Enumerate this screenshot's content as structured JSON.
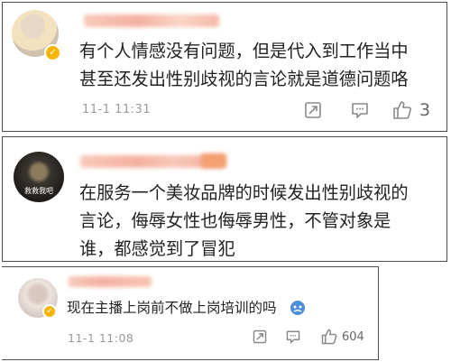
{
  "colors": {
    "border": "#4d4d4d",
    "text": "#222222",
    "meta": "#9a9a9a",
    "verified_badge": "#f7b500",
    "name_blur": "#f5b9a8"
  },
  "comments": [
    {
      "avatar_icon": "user-avatar-icon",
      "verified_icon": "verified-badge-icon",
      "lines": [
        "有个人情感没有问题，但是代入到工作当中",
        "甚至还发出性别歧视的言论就是道德问题咯"
      ],
      "time": "11-1 11:31",
      "share_icon": "share-icon",
      "reply_icon": "comment-icon",
      "like_icon": "thumbs-up-icon",
      "likes": "3"
    },
    {
      "avatar_icon": "user-avatar-icon",
      "avatar_caption": "救救我吧",
      "lines": [
        "在服务一个美妆品牌的时候发出性别歧视的",
        "言论，侮辱女性也侮辱男性，不管对象是",
        "谁，都感觉到了冒犯"
      ]
    },
    {
      "avatar_icon": "user-avatar-icon",
      "verified_icon": "verified-badge-icon",
      "lines": [
        "现在主播上岗前不做上岗培训的吗"
      ],
      "emoji_icon": "crying-face-emoji-icon",
      "time": "11-1 11:08",
      "share_icon": "share-icon",
      "reply_icon": "comment-icon",
      "like_icon": "thumbs-up-icon",
      "likes": "604"
    }
  ]
}
